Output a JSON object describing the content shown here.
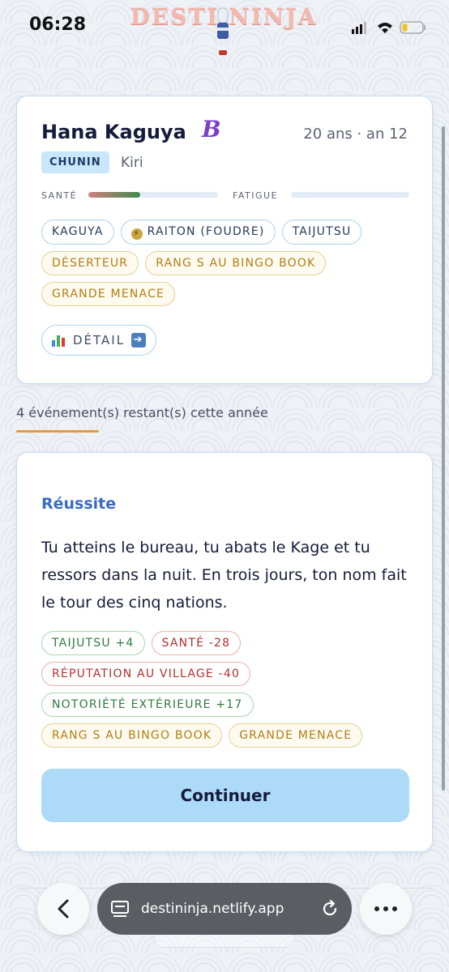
{
  "status_bar": {
    "time": "06:28"
  },
  "app": {
    "logo_text": "DESTI NINJA"
  },
  "character": {
    "name": "Hana Kaguya",
    "grade": "B",
    "age_line": "20 ans · an 12",
    "rank": "CHUNIN",
    "village": "Kiri",
    "health_label": "SANTÉ",
    "health_level": 0.4,
    "fatigue_label": "FATIGUE",
    "fatigue_level": 0,
    "tags": [
      {
        "label": "KAGUYA",
        "style": "blue"
      },
      {
        "label": "RAITON (FOUDRE)",
        "style": "blue",
        "icon": "lightning-icon"
      },
      {
        "label": "TAIJUTSU",
        "style": "blue"
      },
      {
        "label": "DÉSERTEUR",
        "style": "gold"
      },
      {
        "label": "RANG S AU BINGO BOOK",
        "style": "gold"
      },
      {
        "label": "GRANDE MENACE",
        "style": "gold"
      }
    ],
    "detail_button": "DÉTAIL"
  },
  "events": {
    "remaining_text": "4 événement(s) restant(s) cette année"
  },
  "outcome": {
    "title": "Réussite",
    "narrative": "Tu atteins le bureau, tu abats le Kage et tu ressors dans la nuit. En trois jours, ton nom fait le tour des cinq nations.",
    "effects": [
      {
        "label": "TAIJUTSU +4",
        "style": "green"
      },
      {
        "label": "SANTÉ -28",
        "style": "red"
      },
      {
        "label": "RÉPUTATION AU VILLAGE -40",
        "style": "red"
      },
      {
        "label": "NOTORIÉTÉ EXTÉRIEURE +17",
        "style": "green"
      },
      {
        "label": "RANG S AU BINGO BOOK",
        "style": "gold"
      },
      {
        "label": "GRANDE MENACE",
        "style": "gold"
      }
    ],
    "continue_button": "Continuer"
  },
  "browser": {
    "url": "destininja.netlify.app"
  },
  "colors": {
    "accent": "#3a6bc4",
    "button_bg": "#addaf7",
    "progress": "#e59a3c"
  }
}
